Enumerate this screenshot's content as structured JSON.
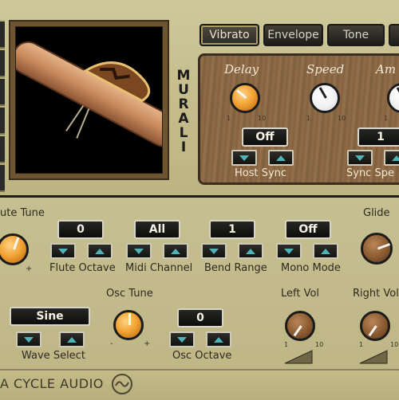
{
  "app": {
    "name_vertical": [
      "M",
      "U",
      "R",
      "A",
      "L",
      "I"
    ],
    "footer_text": "A CYCLE AUDIO"
  },
  "tabs": [
    {
      "label": "Vibrato",
      "active": true
    },
    {
      "label": "Envelope",
      "active": false
    },
    {
      "label": "Tone",
      "active": false
    }
  ],
  "vibrato_panel": {
    "knobs": [
      {
        "label": "Delay",
        "min": "1",
        "max": "10"
      },
      {
        "label": "Speed",
        "min": "1",
        "max": "10"
      },
      {
        "label": "Am",
        "min": "1",
        "max": ""
      }
    ],
    "host_sync": {
      "value": "Off",
      "label": "Host Sync"
    },
    "sync_speed": {
      "value": "1",
      "label": "Sync Spe"
    }
  },
  "main": {
    "flute_tune": {
      "label": "ute Tune",
      "minus": "-",
      "plus": "+"
    },
    "selectors": [
      {
        "label": "Flute Octave",
        "value": "0"
      },
      {
        "label": "Midi Channel",
        "value": "All"
      },
      {
        "label": "Bend Range",
        "value": "1"
      },
      {
        "label": "Mono Mode",
        "value": "Off"
      }
    ],
    "glide": {
      "label": "Glide"
    },
    "wave_select": {
      "label": "Wave Select",
      "value": "Sine"
    },
    "osc_tune": {
      "label": "Osc Tune",
      "minus": "-",
      "plus": "+"
    },
    "osc_octave": {
      "label": "Osc Octave",
      "value": "0"
    },
    "left_vol": {
      "label": "Left Vol",
      "min": "1",
      "max": "10"
    },
    "right_vol": {
      "label": "Right Vol",
      "min": "1",
      "max": "10"
    }
  },
  "colors": {
    "accent": "#f0a030",
    "arrow": "#4fb3b8",
    "wood": "#8c6a46",
    "panel": "#c6bf90"
  }
}
